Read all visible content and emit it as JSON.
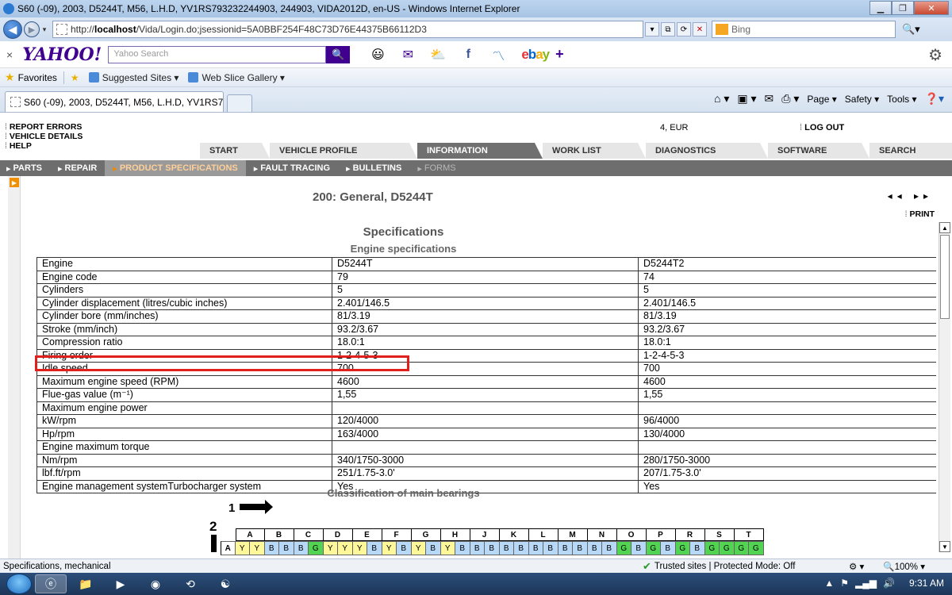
{
  "window": {
    "title": "S60 (-09), 2003, D5244T, M56, L.H.D, YV1RS793232244903, 244903, VIDA2012D, en-US - Windows Internet Explorer"
  },
  "address": {
    "url_prefix": "http://",
    "url_host": "localhost",
    "url_path": "/Vida/Login.do;jsessionid=5A0BBF254F48C73D76E44375B66112D3",
    "search_placeholder": "Bing"
  },
  "yahoo": {
    "close": "×",
    "logo": "YAHOO!",
    "search_placeholder": "Yahoo Search",
    "ebay": [
      "e",
      "b",
      "a",
      "y"
    ]
  },
  "favorites": {
    "label": "Favorites",
    "items": [
      "Suggested Sites ▾",
      "Web Slice Gallery ▾"
    ]
  },
  "tab": {
    "title": "S60 (-09), 2003, D5244T, M56, L.H.D, YV1RS793232..."
  },
  "cmdbar": {
    "page": "Page ▾",
    "safety": "Safety ▾",
    "tools": "Tools ▾"
  },
  "vida": {
    "header_links": [
      "REPORT ERRORS",
      "VEHICLE DETAILS",
      "HELP"
    ],
    "currency": "4, EUR",
    "logout": "LOG OUT",
    "main_tabs": [
      "START",
      "VEHICLE PROFILE",
      "INFORMATION",
      "WORK LIST",
      "DIAGNOSTICS",
      "SOFTWARE",
      "SEARCH"
    ],
    "active_main_tab": "INFORMATION",
    "sub_tabs": [
      "PARTS",
      "REPAIR",
      "PRODUCT SPECIFICATIONS",
      "FAULT TRACING",
      "BULLETINS",
      "FORMS"
    ],
    "active_sub_tab": "PRODUCT SPECIFICATIONS"
  },
  "document": {
    "title": "200: General, D5244T",
    "nav": "◂◂ ▸▸",
    "print": "PRINT",
    "section": "Specifications",
    "subsection": "Engine specifications",
    "rows": [
      [
        "Engine",
        "D5244T",
        "D5244T2"
      ],
      [
        "Engine code",
        "79",
        "74"
      ],
      [
        "Cylinders",
        "5",
        "5"
      ],
      [
        "Cylinder displacement (litres/cubic inches)",
        "2.401/146.5",
        "2.401/146.5"
      ],
      [
        "Cylinder bore (mm/inches)",
        "81/3.19",
        "81/3.19"
      ],
      [
        "Stroke (mm/inch)",
        "93.2/3.67",
        "93.2/3.67"
      ],
      [
        "Compression ratio",
        "18.0:1",
        "18.0:1"
      ],
      [
        "Firing order",
        "1-2-4-5-3",
        "1-2-4-5-3"
      ],
      [
        "Idle speed",
        "700",
        "700"
      ],
      [
        "Maximum engine speed (RPM)",
        "4600",
        "4600"
      ],
      [
        "Flue-gas value (m⁻¹)",
        "1,55",
        "1,55"
      ],
      [
        "Maximum engine power",
        "",
        ""
      ],
      [
        "kW/rpm",
        "120/4000",
        "96/4000"
      ],
      [
        "Hp/rpm",
        "163/4000",
        "130/4000"
      ],
      [
        "Engine maximum torque",
        "",
        ""
      ],
      [
        "Nm/rpm",
        "340/1750-3000",
        "280/1750-3000"
      ],
      [
        "lbf.ft/rpm",
        "251/1.75-3.0'",
        "207/1.75-3.0'"
      ],
      [
        "Engine management systemTurbocharger system",
        "Yes",
        "Yes"
      ]
    ],
    "bearing_title": "Classification of main bearings",
    "bearing_label_1": "1",
    "bearing_label_2": "2",
    "bearing_columns": [
      "A",
      "B",
      "C",
      "D",
      "E",
      "F",
      "G",
      "H",
      "J",
      "K",
      "L",
      "M",
      "N",
      "O",
      "P",
      "R",
      "S",
      "T"
    ],
    "bearing_row_label": "A",
    "bearing_cells": [
      "Y",
      "Y",
      "B",
      "B",
      "B",
      "G",
      "Y",
      "Y",
      "Y",
      "B",
      "Y",
      "B",
      "Y",
      "B",
      "Y",
      "B",
      "B",
      "B",
      "B",
      "B",
      "B",
      "B",
      "B",
      "B",
      "B",
      "B",
      "G",
      "B",
      "G",
      "B",
      "G",
      "B",
      "G",
      "G",
      "G",
      "G"
    ]
  },
  "status": {
    "message": "Specifications, mechanical",
    "zone": "Trusted sites | Protected Mode: Off",
    "zoom": "🔍100% ▾"
  },
  "taskbar": {
    "clock": "9:31 AM"
  }
}
